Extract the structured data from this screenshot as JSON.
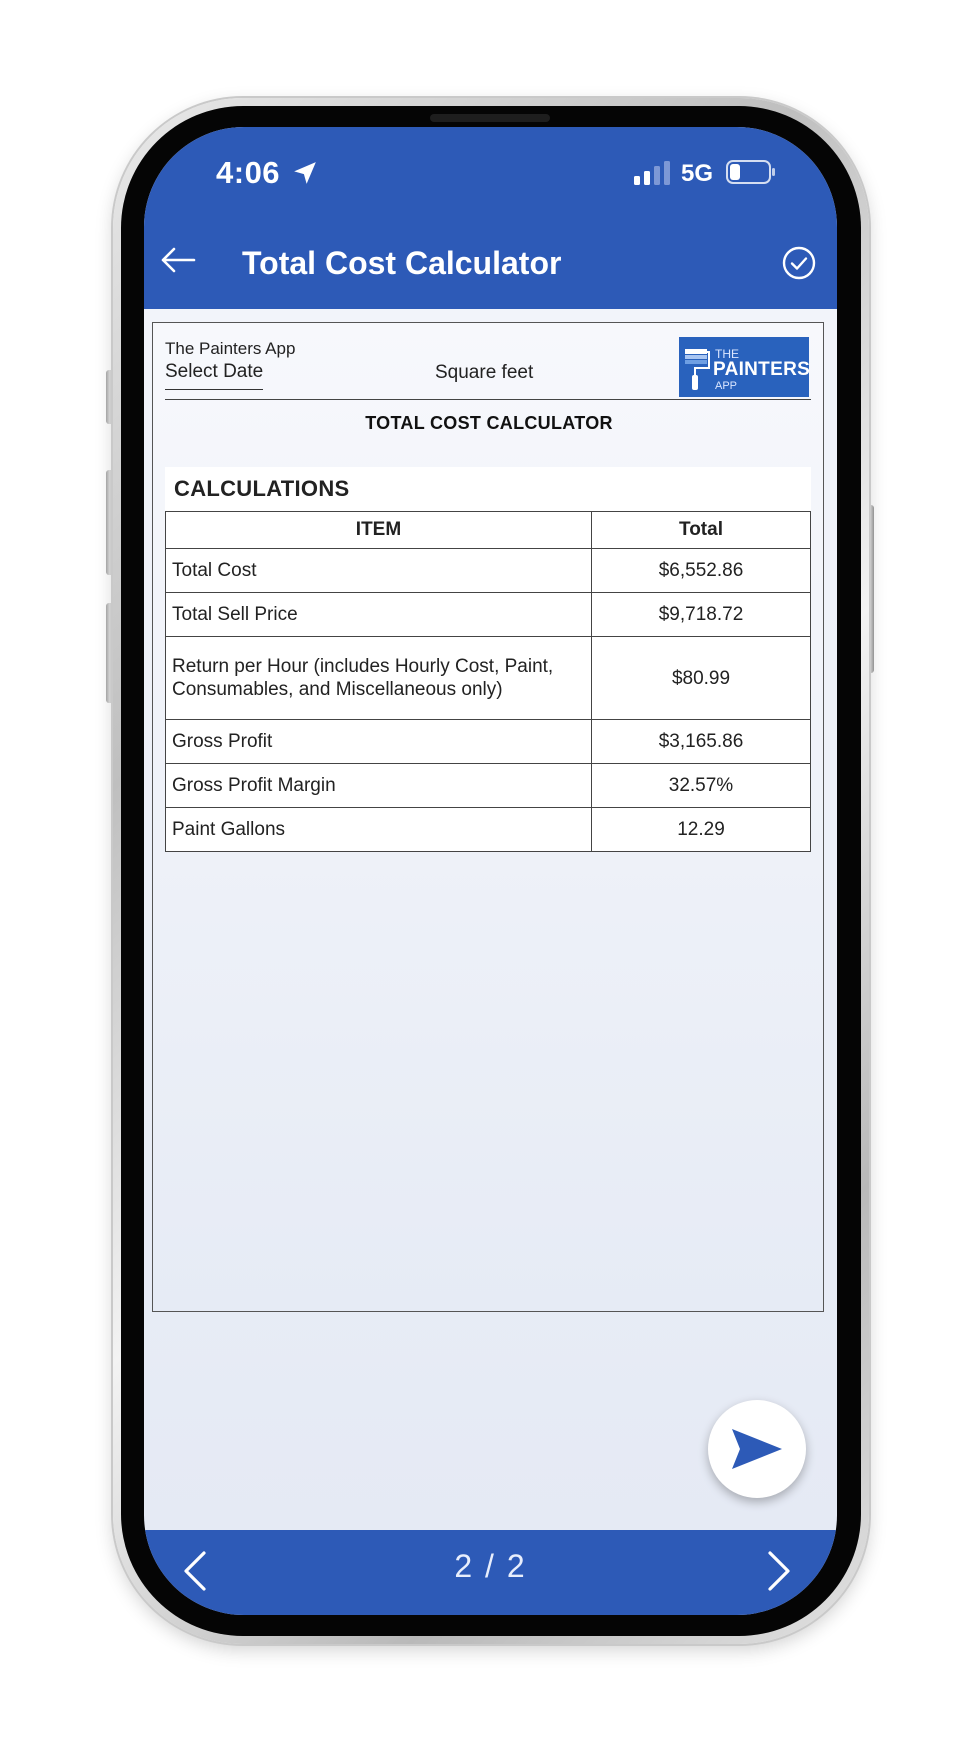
{
  "status_bar": {
    "time": "4:06",
    "network": "5G"
  },
  "header": {
    "title": "Total Cost Calculator"
  },
  "document": {
    "app_name": "The Painters App",
    "select_date": "Select Date",
    "square_feet": "Square feet",
    "logo": {
      "the": "THE",
      "main": "PAINTERS",
      "app": "APP"
    },
    "heading": "TOTAL COST CALCULATOR",
    "calculations": {
      "title": "CALCULATIONS",
      "columns": [
        "ITEM",
        "Total"
      ],
      "rows": [
        {
          "item": "Total Cost",
          "total": "$6,552.86"
        },
        {
          "item": "Total Sell Price",
          "total": "$9,718.72"
        },
        {
          "item": "Return per Hour (includes Hourly Cost, Paint, Consumables, and Miscellaneous only)",
          "total": "$80.99"
        },
        {
          "item": "Gross Profit",
          "total": "$3,165.86"
        },
        {
          "item": "Gross Profit Margin",
          "total": "32.57%"
        },
        {
          "item": "Paint Gallons",
          "total": "12.29"
        }
      ]
    }
  },
  "pager": {
    "text": "2 / 2"
  },
  "colors": {
    "brand_blue": "#2d5ab7",
    "logo_blue": "#2962bd"
  },
  "icons": [
    "location-arrow-icon",
    "signal-icon",
    "battery-icon",
    "back-arrow-icon",
    "check-circle-icon",
    "send-icon",
    "chevron-left-icon",
    "chevron-right-icon"
  ]
}
